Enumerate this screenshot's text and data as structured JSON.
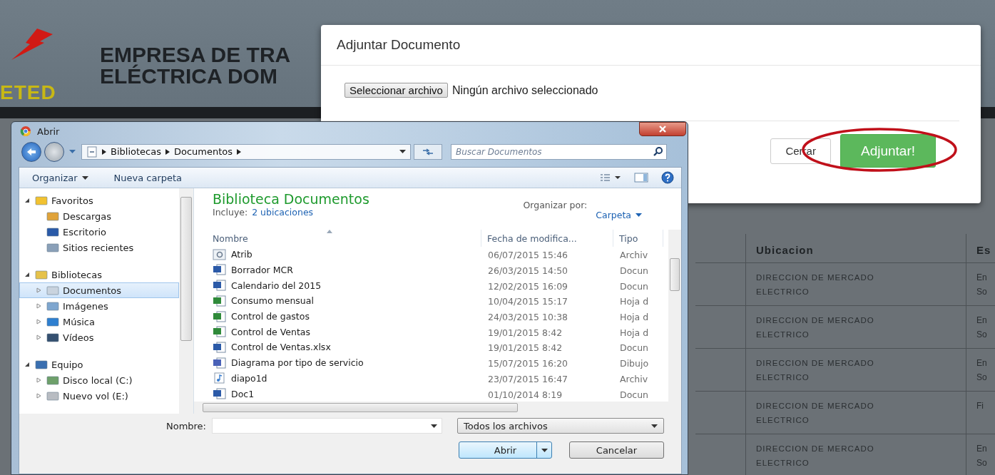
{
  "page": {
    "header": {
      "logo_text": "ETED",
      "title_lines": [
        "EMPRESA DE TRA",
        "ELÉCTRICA DOM"
      ]
    },
    "table": {
      "columns": [
        "Ubicacion",
        "Es"
      ],
      "rows": [
        {
          "ubicacion": "DIRECCION DE MERCADO ELECTRICO",
          "column_3": [
            "En",
            "So"
          ]
        },
        {
          "ubicacion": "DIRECCION DE MERCADO ELECTRICO",
          "column_3": [
            "En",
            "So"
          ]
        },
        {
          "ubicacion": "DIRECCION DE MERCADO ELECTRICO",
          "column_3": [
            "En",
            "So"
          ]
        },
        {
          "ubicacion": "DIRECCION DE MERCADO ELECTRICO",
          "column_3": [
            "Fi"
          ]
        },
        {
          "ubicacion": "DIRECCION DE MERCADO ELECTRICO",
          "column_3": [
            "En",
            "So"
          ]
        }
      ]
    }
  },
  "modal": {
    "title": "Adjuntar Documento",
    "file_button": "Seleccionar archivo",
    "file_status": "Ningún archivo seleccionado",
    "buttons": [
      {
        "label": "Cerrar",
        "kind": "default",
        "highlighted": false
      },
      {
        "label": "Adjuntar!",
        "kind": "primary",
        "highlighted": true
      }
    ]
  },
  "dialog": {
    "title": "Abrir",
    "breadcrumb": [
      "Bibliotecas",
      "Documentos"
    ],
    "search": {
      "placeholder": "Buscar Documentos"
    },
    "toolbar": [
      "Organizar",
      "Nueva carpeta"
    ],
    "nav": [
      {
        "label": "Favoritos",
        "expanded": true,
        "selected": false,
        "children": [
          {
            "label": "Descargas",
            "selected": false
          },
          {
            "label": "Escritorio",
            "selected": false
          },
          {
            "label": "Sitios recientes",
            "selected": false
          }
        ]
      },
      {
        "label": "Bibliotecas",
        "expanded": true,
        "selected": false,
        "children": [
          {
            "label": "Documentos",
            "expanded": false,
            "selected": true
          },
          {
            "label": "Imágenes",
            "expanded": false,
            "selected": false
          },
          {
            "label": "Música",
            "expanded": false,
            "selected": false
          },
          {
            "label": "Vídeos",
            "expanded": false,
            "selected": false
          }
        ]
      },
      {
        "label": "Equipo",
        "expanded": true,
        "selected": false,
        "children": [
          {
            "label": "Disco local (C:)",
            "expanded": false,
            "selected": false
          },
          {
            "label": "Nuevo vol (E:)",
            "expanded": false,
            "selected": false
          }
        ]
      }
    ],
    "library": {
      "title": "Biblioteca Documentos",
      "includes_label": "Incluye:",
      "includes_link": "2 ubicaciones",
      "arrange_label": "Organizar por:",
      "arrange_value": "Carpeta"
    },
    "columns": [
      "Nombre",
      "Fecha de modifica...",
      "Tipo"
    ],
    "files": [
      {
        "kind": "settings",
        "name": "Atrib",
        "date": "06/07/2015 15:46",
        "type": "Archiv"
      },
      {
        "kind": "word",
        "name": "Borrador MCR",
        "date": "26/03/2015 14:50",
        "type": "Docun"
      },
      {
        "kind": "word",
        "name": "Calendario del 2015",
        "date": "12/02/2015 16:09",
        "type": "Docun"
      },
      {
        "kind": "excel",
        "name": "Consumo mensual",
        "date": "10/04/2015 15:17",
        "type": "Hoja d"
      },
      {
        "kind": "excel",
        "name": "Control de gastos",
        "date": "24/03/2015 10:38",
        "type": "Hoja d"
      },
      {
        "kind": "excel",
        "name": "Control de Ventas",
        "date": "19/01/2015 8:42",
        "type": "Hoja d"
      },
      {
        "kind": "word",
        "name": "Control de Ventas.xlsx",
        "date": "19/01/2015 8:42",
        "type": "Docun"
      },
      {
        "kind": "visio",
        "name": "Diagrama por tipo de servicio",
        "date": "15/07/2015 16:20",
        "type": "Dibujo"
      },
      {
        "kind": "audio",
        "name": "diapo1d",
        "date": "23/07/2015 16:47",
        "type": "Archiv"
      },
      {
        "kind": "word",
        "name": "Doc1",
        "date": "01/10/2014 8:19",
        "type": "Docun"
      }
    ],
    "filename_label": "Nombre:",
    "filter": "Todos los archivos",
    "buttons": [
      "Abrir",
      "Cancelar"
    ]
  }
}
